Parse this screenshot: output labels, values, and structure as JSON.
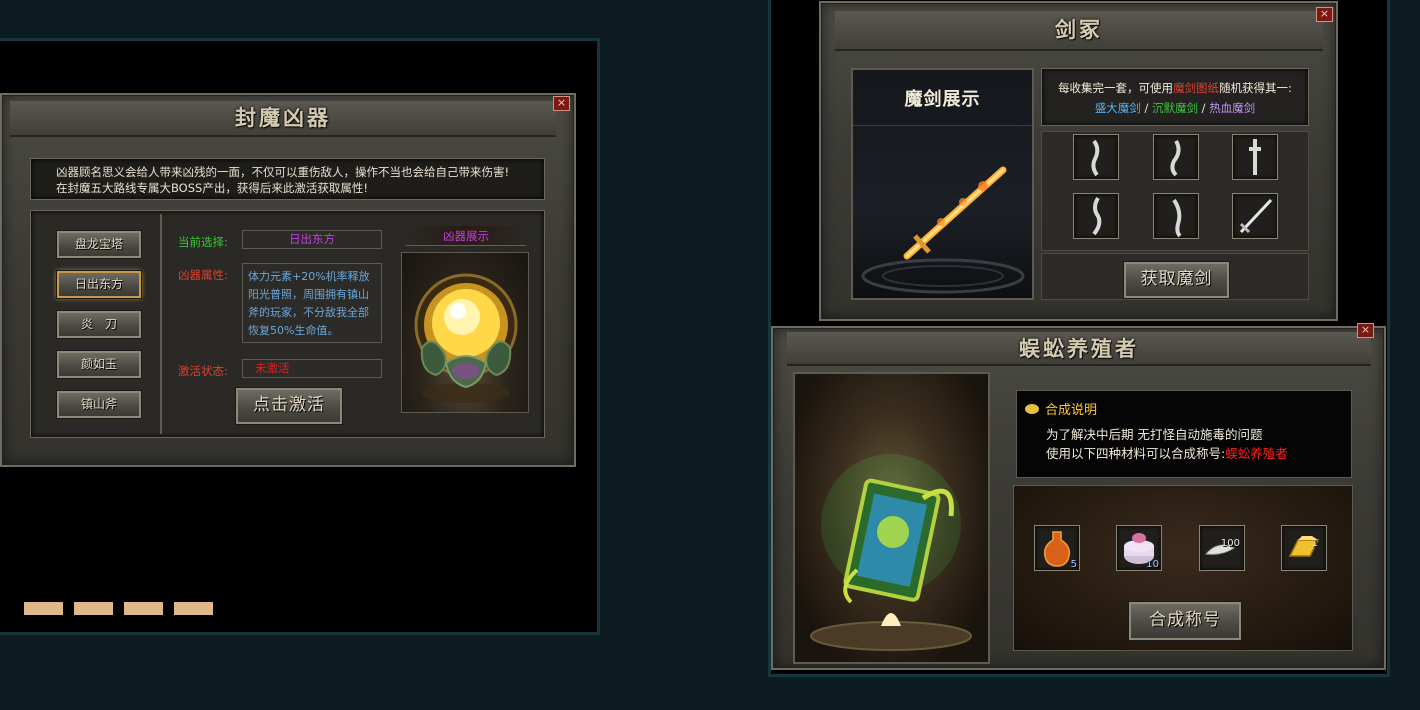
{
  "fengmo": {
    "title": "封魔凶器",
    "close": "×",
    "desc_line1": "凶器顾名思义会给人带来凶残的一面，不仅可以重伤敌人，操作不当也会给自己带来伤害!",
    "desc_line2": "在封魔五大路线专属大BOSS产出，获得后来此激活获取属性!",
    "weapons": [
      "盘龙宝塔",
      "日出东方",
      "炎　刀",
      "颜如玉",
      "镇山斧"
    ],
    "selected_index": 1,
    "current_label": "当前选择:",
    "current_value": "日出东方",
    "attr_label": "凶器属性:",
    "attr_text": "体力元素+20%机率释放阳光普照，周围拥有镇山斧的玩家，不分敌我全部恢复50%生命值。",
    "status_label": "激活状态:",
    "status_value": "未激活",
    "activate_button": "点击激活",
    "showcase_label": "凶器展示"
  },
  "pagination": {
    "count": 4
  },
  "jianzhong": {
    "title": "剑冢",
    "close": "×",
    "showcase_title": "魔剑展示",
    "info_prefix": "每收集完一套，可使用",
    "info_highlight": "魔剑图纸",
    "info_suffix": "随机获得其一:",
    "sword1": "盛大魔剑",
    "sep1": " / ",
    "sword2": "沉默魔剑",
    "sep2": " / ",
    "sword3": "热血魔剑",
    "slot_icons": [
      "sword-fragment-icon",
      "sword-fragment-icon",
      "sword-fragment-icon",
      "sword-fragment-icon",
      "sword-fragment-icon",
      "sword-icon"
    ],
    "get_button": "获取魔剑"
  },
  "wugong": {
    "title": "蜈蚣养殖者",
    "close": "×",
    "section_title": "合成说明",
    "line1": "为了解决中后期 无打怪自动施毒的问题",
    "line2_prefix": "使用以下四种材料可以合成称号:",
    "line2_highlight": "蜈蚣养殖者",
    "materials": [
      {
        "icon": "potion-icon",
        "qty": "5"
      },
      {
        "icon": "cake-icon",
        "qty": "10"
      },
      {
        "icon": "feather-icon",
        "qty": "100"
      },
      {
        "icon": "gold-bar-icon",
        "qty": "1"
      }
    ],
    "craft_button": "合成称号"
  },
  "colors": {
    "green_label": "#3cc43c",
    "red_label": "#e04030",
    "purple_value": "#c040e0",
    "blue_text": "#6ca6d8",
    "pink_highlight": "#e8609a"
  }
}
